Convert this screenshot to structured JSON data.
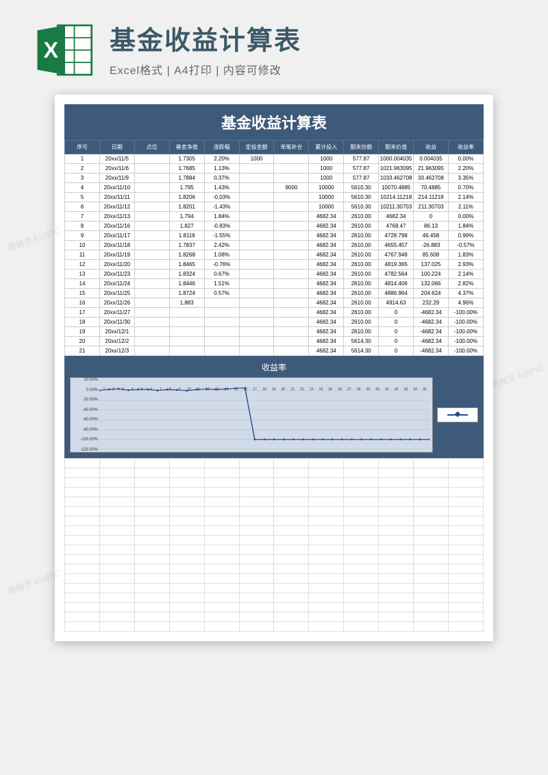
{
  "header": {
    "title": "基金收益计算表",
    "subtitle": "Excel格式 | A4打印 | 内容可修改"
  },
  "sheet": {
    "title": "基金收益计算表",
    "columns": [
      "序号",
      "日期",
      "点位",
      "基金净值",
      "涨跌幅",
      "定投金额",
      "单笔补仓",
      "累计投入",
      "期末份额",
      "期末价值",
      "收益",
      "收益率"
    ],
    "rows": [
      [
        "1",
        "20xx/11/5",
        "",
        "1.7305",
        "2.20%",
        "1000",
        "",
        "1000",
        "577.87",
        "1000.004035",
        "0.004035",
        "0.00%"
      ],
      [
        "2",
        "20xx/11/6",
        "",
        "1.7685",
        "1.13%",
        "",
        "",
        "1000",
        "577.87",
        "1021.963095",
        "21.963095",
        "2.20%"
      ],
      [
        "3",
        "20xx/11/9",
        "",
        "1.7884",
        "0.37%",
        "",
        "",
        "1000",
        "577.87",
        "1033.462708",
        "33.462708",
        "3.35%"
      ],
      [
        "4",
        "20xx/11/10",
        "",
        "1.795",
        "1.43%",
        "",
        "9000",
        "10000",
        "5610.30",
        "10070.4885",
        "70.4885",
        "0.70%"
      ],
      [
        "5",
        "20xx/11/11",
        "",
        "1.8206",
        "-0.03%",
        "",
        "",
        "10000",
        "5610.30",
        "10214.11218",
        "214.11218",
        "2.14%"
      ],
      [
        "6",
        "20xx/11/12",
        "",
        "1.8201",
        "-1.43%",
        "",
        "",
        "10000",
        "5610.30",
        "10211.30703",
        "211.30703",
        "2.11%"
      ],
      [
        "7",
        "20xx/11/13",
        "",
        "1.794",
        "1.84%",
        "",
        "",
        "4682.34",
        "2610.00",
        "4682.34",
        "0",
        "0.00%"
      ],
      [
        "8",
        "20xx/11/16",
        "",
        "1.827",
        "-0.83%",
        "",
        "",
        "4682.34",
        "2610.00",
        "4768.47",
        "86.13",
        "1.84%"
      ],
      [
        "9",
        "20xx/11/17",
        "",
        "1.8118",
        "-1.55%",
        "",
        "",
        "4682.34",
        "2610.00",
        "4728.798",
        "46.458",
        "0.99%"
      ],
      [
        "10",
        "20xx/11/18",
        "",
        "1.7837",
        "2.42%",
        "",
        "",
        "4682.34",
        "2610.00",
        "4655.457",
        "-26.883",
        "-0.57%"
      ],
      [
        "11",
        "20xx/11/19",
        "",
        "1.8268",
        "1.08%",
        "",
        "",
        "4682.34",
        "2610.00",
        "4767.948",
        "85.608",
        "1.83%"
      ],
      [
        "12",
        "20xx/11/20",
        "",
        "1.8465",
        "-0.76%",
        "",
        "",
        "4682.34",
        "2610.00",
        "4819.365",
        "137.025",
        "2.93%"
      ],
      [
        "13",
        "20xx/11/23",
        "",
        "1.8324",
        "0.67%",
        "",
        "",
        "4682.34",
        "2610.00",
        "4782.564",
        "100.224",
        "2.14%"
      ],
      [
        "14",
        "20xx/11/24",
        "",
        "1.8446",
        "1.51%",
        "",
        "",
        "4682.34",
        "2610.00",
        "4814.406",
        "132.066",
        "2.82%"
      ],
      [
        "15",
        "20xx/11/25",
        "",
        "1.8724",
        "0.57%",
        "",
        "",
        "4682.34",
        "2610.00",
        "4886.964",
        "204.624",
        "4.37%"
      ],
      [
        "16",
        "20xx/11/26",
        "",
        "1.883",
        "",
        "",
        "",
        "4682.34",
        "2610.00",
        "4914.63",
        "232.29",
        "4.96%"
      ],
      [
        "17",
        "20xx/11/27",
        "",
        "",
        "",
        "",
        "",
        "4682.34",
        "2610.00",
        "0",
        "-4682.34",
        "-100.00%"
      ],
      [
        "18",
        "20xx/11/30",
        "",
        "",
        "",
        "",
        "",
        "4682.34",
        "2610.00",
        "0",
        "-4682.34",
        "-100.00%"
      ],
      [
        "19",
        "20xx/12/1",
        "",
        "",
        "",
        "",
        "",
        "4682.34",
        "2610.00",
        "0",
        "-4682.34",
        "-100.00%"
      ],
      [
        "20",
        "20xx/12/2",
        "",
        "",
        "",
        "",
        "",
        "4682.34",
        "5614.30",
        "0",
        "-4682.34",
        "-100.00%"
      ],
      [
        "21",
        "20xx/12/3",
        "",
        "",
        "",
        "",
        "",
        "4682.34",
        "5614.30",
        "0",
        "-4682.34",
        "-100.00%"
      ]
    ]
  },
  "chart_data": {
    "type": "line",
    "title": "收益率",
    "ylabel": "",
    "ylim": [
      -120,
      20
    ],
    "y_ticks": [
      "20.00%",
      "0.00%",
      "-20.00%",
      "-40.00%",
      "-60.00%",
      "-80.00%",
      "-100.00%",
      "-120.00%"
    ],
    "x": [
      1,
      2,
      3,
      4,
      5,
      6,
      7,
      8,
      9,
      10,
      11,
      12,
      13,
      14,
      15,
      16,
      17,
      18,
      19,
      20,
      21,
      22,
      23,
      24,
      25,
      26,
      27,
      28,
      29,
      30,
      31,
      32,
      33,
      34,
      35
    ],
    "values": [
      0,
      2.2,
      3.35,
      0.7,
      2.14,
      2.11,
      0,
      1.84,
      0.99,
      -0.57,
      1.83,
      2.93,
      2.14,
      2.82,
      4.37,
      4.96,
      -100,
      -100,
      -100,
      -100,
      -100,
      -100,
      -100,
      -100,
      -100,
      -100,
      -100,
      -100,
      -100,
      -100,
      -100,
      -100,
      -100,
      -100,
      -100
    ]
  },
  "watermark": "图精灵 616PIC"
}
